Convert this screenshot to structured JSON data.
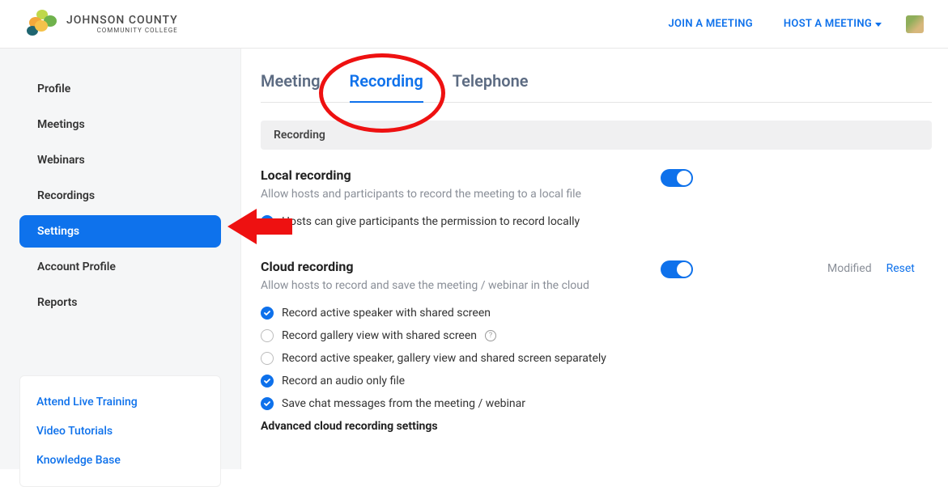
{
  "header": {
    "logo_main": "JOHNSON COUNTY",
    "logo_sub": "COMMUNITY COLLEGE",
    "join_label": "JOIN A MEETING",
    "host_label": "HOST A MEETING"
  },
  "sidebar": {
    "items": [
      {
        "label": "Profile"
      },
      {
        "label": "Meetings"
      },
      {
        "label": "Webinars"
      },
      {
        "label": "Recordings"
      },
      {
        "label": "Settings"
      },
      {
        "label": "Account Profile"
      },
      {
        "label": "Reports"
      }
    ],
    "active_index": 4,
    "links": [
      {
        "label": "Attend Live Training"
      },
      {
        "label": "Video Tutorials"
      },
      {
        "label": "Knowledge Base"
      }
    ]
  },
  "tabs": {
    "items": [
      {
        "label": "Meeting"
      },
      {
        "label": "Recording"
      },
      {
        "label": "Telephone"
      }
    ],
    "active_index": 1
  },
  "section_header": "Recording",
  "local": {
    "title": "Local recording",
    "desc": "Allow hosts and participants to record the meeting to a local file",
    "toggle_on": true,
    "opt1_label": "Hosts can give participants the permission to record locally",
    "opt1_checked": true
  },
  "cloud": {
    "title": "Cloud recording",
    "desc": "Allow hosts to record and save the meeting / webinar in the cloud",
    "toggle_on": true,
    "modified_label": "Modified",
    "reset_label": "Reset",
    "opts": [
      {
        "label": "Record active speaker with shared screen",
        "checked": true,
        "info": false
      },
      {
        "label": "Record gallery view with shared screen",
        "checked": false,
        "info": true
      },
      {
        "label": "Record active speaker, gallery view and shared screen separately",
        "checked": false,
        "info": false
      },
      {
        "label": "Record an audio only file",
        "checked": true,
        "info": false
      },
      {
        "label": "Save chat messages from the meeting / webinar",
        "checked": true,
        "info": false
      }
    ],
    "advanced_heading": "Advanced cloud recording settings"
  }
}
